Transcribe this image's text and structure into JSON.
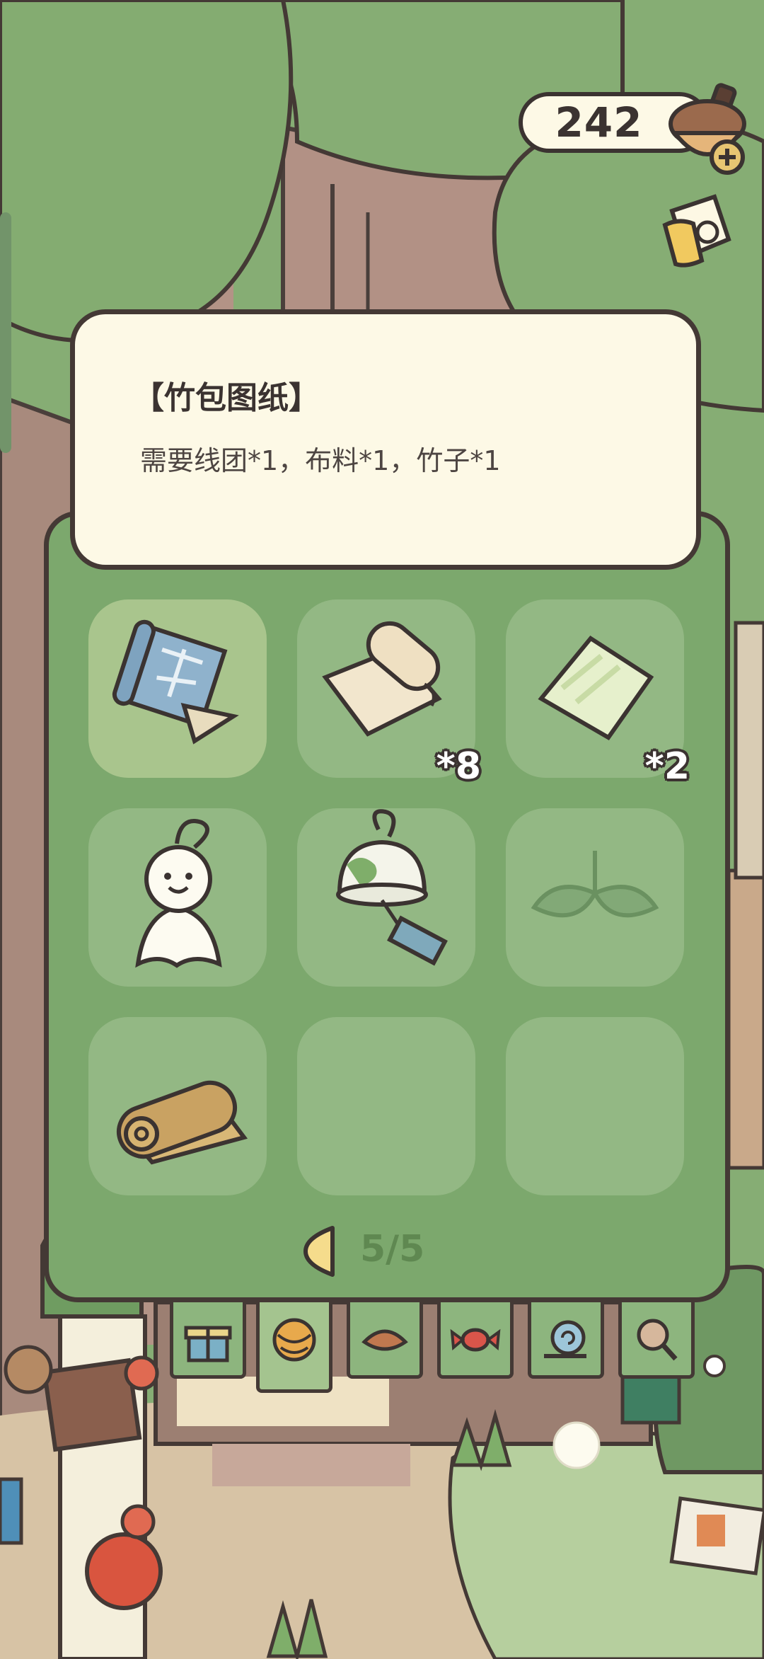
{
  "currency": {
    "value": "242",
    "icon": "acorn-plus-icon"
  },
  "side_button": {
    "icon": "ticket-icon"
  },
  "info_box": {
    "title": "【竹包图纸】",
    "description": "需要线团*1，布料*1，竹子*1"
  },
  "inventory": {
    "slots": [
      {
        "icon": "blueprint-icon",
        "count": "",
        "selected": true
      },
      {
        "icon": "fabric-roll-icon",
        "count": "*8"
      },
      {
        "icon": "glass-pane-icon",
        "count": "*2"
      },
      {
        "icon": "teru-teru-bozu-icon",
        "count": ""
      },
      {
        "icon": "wind-chime-icon",
        "count": ""
      },
      {
        "icon": "bamboo-leaf-icon",
        "count": ""
      },
      {
        "icon": "straw-mat-icon",
        "count": ""
      },
      {
        "icon": "",
        "count": ""
      },
      {
        "icon": "",
        "count": ""
      }
    ],
    "page": "5/5"
  },
  "shop_tabs": [
    {
      "icon": "gift-icon"
    },
    {
      "icon": "yarn-ball-icon",
      "active": true
    },
    {
      "icon": "food-icon"
    },
    {
      "icon": "candy-icon"
    },
    {
      "icon": "snail-icon"
    },
    {
      "icon": "magnifier-icon"
    }
  ],
  "colors": {
    "panel": "#7ca86d",
    "slot": "#93b884",
    "slot_selected": "#a9c58d",
    "card": "#fdf9e6",
    "outline": "#443935"
  }
}
